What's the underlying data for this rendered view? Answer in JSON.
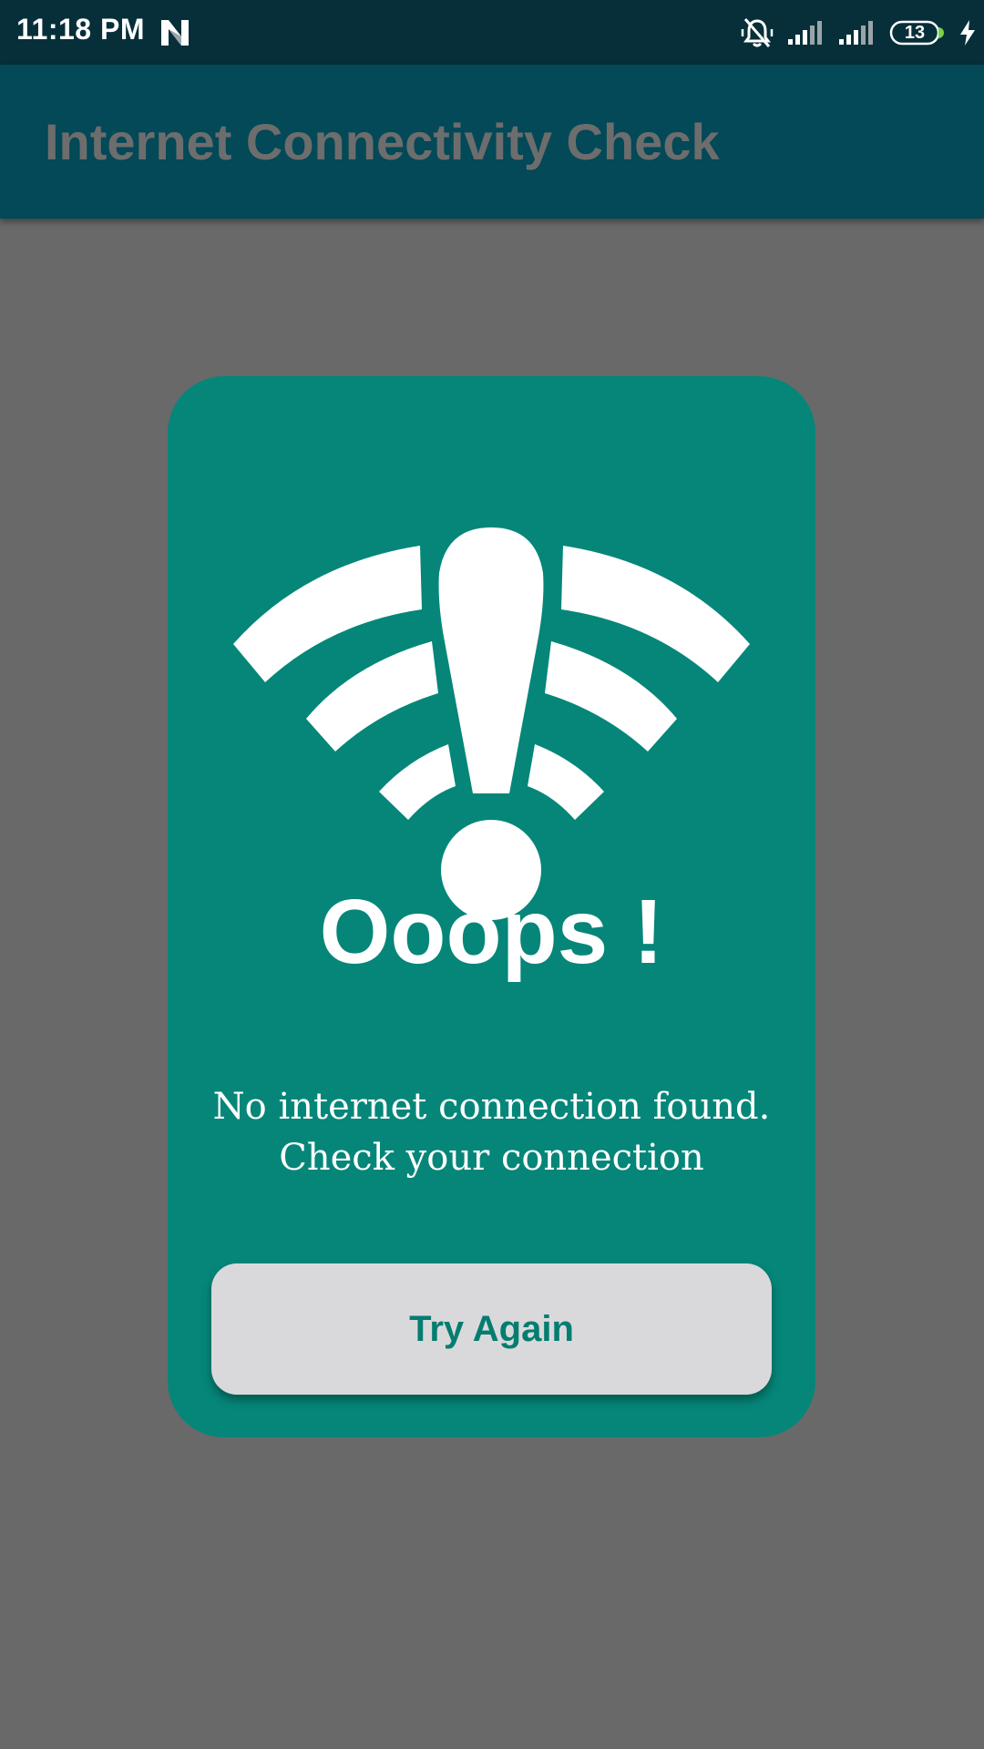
{
  "status_bar": {
    "time": "11:18 PM",
    "battery_level": "13",
    "icons": [
      "n-notification-icon",
      "silent-mode-icon",
      "signal-icon",
      "signal-icon",
      "battery-icon",
      "charging-icon"
    ]
  },
  "app_bar": {
    "title": "Internet Connectivity Check"
  },
  "dialog": {
    "icon": "wifi-error-icon",
    "heading": "Ooops !",
    "message_line1": "No internet connection found.",
    "message_line2": "Check your connection",
    "button_label": "Try Again"
  },
  "colors": {
    "status_bar": "#062f39",
    "app_bar": "#034957",
    "app_title": "#6d6d6d",
    "screen_background": "#696969",
    "card": "#058679",
    "button_background": "#d9d9dc",
    "button_text": "#047d70"
  }
}
